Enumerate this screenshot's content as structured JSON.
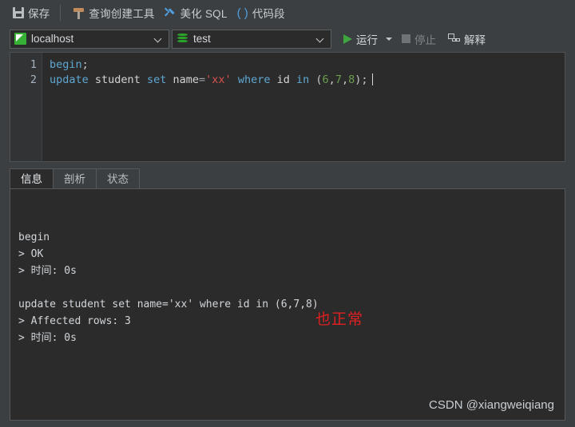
{
  "toolbar": {
    "items": [
      {
        "icon": "save-icon",
        "label": "保存"
      },
      {
        "icon": "hammer-icon",
        "label": "查询创建工具"
      },
      {
        "icon": "sparkle-icon",
        "label": "美化 SQL"
      },
      {
        "icon": "parentheses-icon",
        "label": "代码段"
      }
    ]
  },
  "connection_bar": {
    "connection": {
      "icon": "connection-icon",
      "value": "localhost"
    },
    "database": {
      "icon": "database-icon",
      "value": "test"
    },
    "run": {
      "icon": "play-icon",
      "label": "运行",
      "enabled": true
    },
    "stop": {
      "icon": "stop-icon",
      "label": "停止",
      "enabled": false
    },
    "explain": {
      "icon": "explain-icon",
      "label": "解释",
      "enabled": true
    }
  },
  "editor": {
    "line_numbers": [
      "1",
      "2"
    ],
    "lines": [
      {
        "tokens": [
          {
            "t": "begin",
            "c": "k"
          },
          {
            "t": ";",
            "c": "pn"
          }
        ]
      },
      {
        "tokens": [
          {
            "t": "update",
            "c": "k"
          },
          {
            "t": " ",
            "c": "pn"
          },
          {
            "t": "student",
            "c": "id"
          },
          {
            "t": " ",
            "c": "pn"
          },
          {
            "t": "set",
            "c": "k"
          },
          {
            "t": " ",
            "c": "pn"
          },
          {
            "t": "name",
            "c": "id"
          },
          {
            "t": "=",
            "c": "op"
          },
          {
            "t": "'xx'",
            "c": "str"
          },
          {
            "t": " ",
            "c": "pn"
          },
          {
            "t": "where",
            "c": "k"
          },
          {
            "t": " ",
            "c": "pn"
          },
          {
            "t": "id",
            "c": "id"
          },
          {
            "t": " ",
            "c": "pn"
          },
          {
            "t": "in",
            "c": "k"
          },
          {
            "t": " (",
            "c": "pn"
          },
          {
            "t": "6",
            "c": "num"
          },
          {
            "t": ",",
            "c": "pn"
          },
          {
            "t": "7",
            "c": "num"
          },
          {
            "t": ",",
            "c": "pn"
          },
          {
            "t": "8",
            "c": "num"
          },
          {
            "t": ");",
            "c": "pn"
          }
        ]
      }
    ],
    "plain_text": "begin;\nupdate student set name='xx' where id in (6,7,8);"
  },
  "result_tabs": [
    {
      "label": "信息",
      "active": true
    },
    {
      "label": "剖析",
      "active": false
    },
    {
      "label": "状态",
      "active": false
    }
  ],
  "console": {
    "lines": [
      "begin",
      "> OK",
      "> 时间: 0s",
      "",
      "update student set name='xx' where id in (6,7,8)",
      "> Affected rows: 3",
      "> 时间: 0s"
    ],
    "text": "begin\n> OK\n> 时间: 0s\n\nupdate student set name='xx' where id in (6,7,8)\n> Affected rows: 3\n> 时间: 0s"
  },
  "annotation": {
    "text": "也正常",
    "color": "#e02020"
  },
  "watermark": {
    "text": "CSDN @xiangweiqiang"
  }
}
